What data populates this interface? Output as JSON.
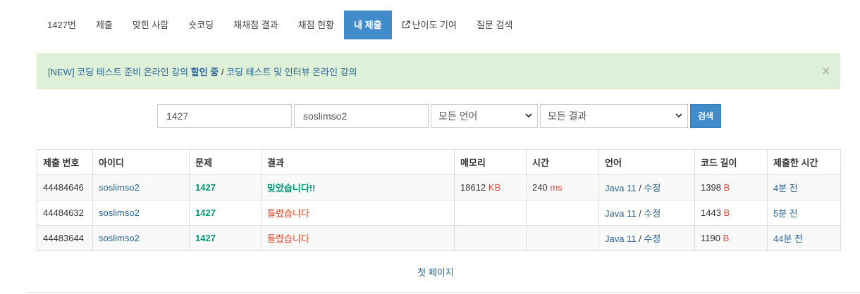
{
  "tabs": [
    "1427번",
    "제출",
    "맞힌 사람",
    "숏코딩",
    "재채점 결과",
    "채점 현황",
    "내 제출",
    "난이도 기여",
    "질문 검색"
  ],
  "active_tab": "내 제출",
  "alert": {
    "part1": "[NEW] 코딩 테스트 준비 온라인 강의 ",
    "bold": "할인 중",
    "sep": " / ",
    "part2": "코딩 테스트 및 인터뷰 온라인 강의",
    "close": "×"
  },
  "search": {
    "problem_value": "1427",
    "user_value": "soslimso2",
    "language": "모든 언어",
    "result": "모든 결과",
    "button": "검색"
  },
  "table": {
    "headers": [
      "제출 번호",
      "아이디",
      "문제",
      "결과",
      "메모리",
      "시간",
      "언어",
      "코드 길이",
      "제출한 시간"
    ],
    "rows": [
      {
        "id": "44484646",
        "user": "soslimso2",
        "problem": "1427",
        "result": "맞았습니다!!",
        "memory": "18612",
        "memory_unit": "KB",
        "time": "240",
        "time_unit": "ms",
        "lang": "Java 11",
        "edit": "수정",
        "length": "1398",
        "length_unit": "B",
        "submitted": "4분 전"
      },
      {
        "id": "44484632",
        "user": "soslimso2",
        "problem": "1427",
        "result": "틀렸습니다",
        "memory": "",
        "memory_unit": "",
        "time": "",
        "time_unit": "",
        "lang": "Java 11",
        "edit": "수정",
        "length": "1443",
        "length_unit": "B",
        "submitted": "5분 전"
      },
      {
        "id": "44483644",
        "user": "soslimso2",
        "problem": "1427",
        "result": "틀렸습니다",
        "memory": "",
        "memory_unit": "",
        "time": "",
        "time_unit": "",
        "lang": "Java 11",
        "edit": "수정",
        "length": "1190",
        "length_unit": "B",
        "submitted": "44분 전"
      }
    ]
  },
  "pager": "첫 페이지",
  "colors": {
    "primary": "#428bca",
    "accepted": "#009874",
    "wrong": "#dd4124",
    "link": "#2a6496",
    "alert_bg": "#dff0d8"
  }
}
